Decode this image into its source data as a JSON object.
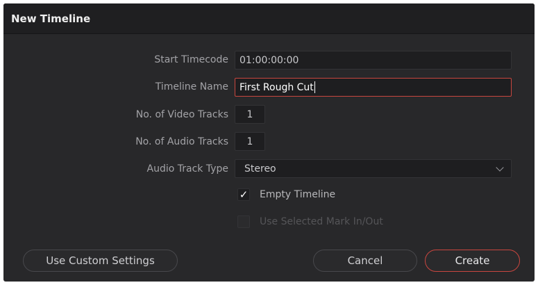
{
  "dialog": {
    "title": "New Timeline"
  },
  "fields": {
    "start_timecode": {
      "label": "Start Timecode",
      "value": "01:00:00:00"
    },
    "timeline_name": {
      "label": "Timeline Name",
      "value": "First Rough Cut"
    },
    "video_tracks": {
      "label": "No. of Video Tracks",
      "value": "1"
    },
    "audio_tracks": {
      "label": "No. of Audio Tracks",
      "value": "1"
    },
    "audio_track_type": {
      "label": "Audio Track Type",
      "value": "Stereo"
    }
  },
  "checkboxes": {
    "empty_timeline": {
      "label": "Empty Timeline",
      "checked": true,
      "mark": "✓"
    },
    "use_selected_mark": {
      "label": "Use Selected Mark In/Out",
      "checked": false,
      "enabled": false
    }
  },
  "buttons": {
    "custom_settings": "Use Custom Settings",
    "cancel": "Cancel",
    "create": "Create"
  },
  "colors": {
    "accent": "#c9463f",
    "background": "#28282a",
    "titlebar": "#1f1f21"
  }
}
